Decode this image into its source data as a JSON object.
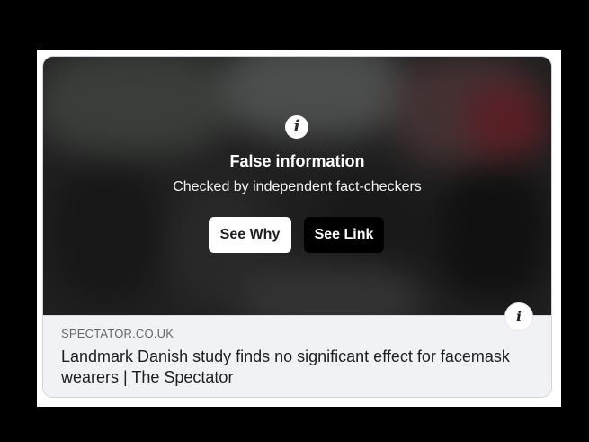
{
  "overlay": {
    "icon": "info-icon",
    "title": "False information",
    "subtitle": "Checked by independent fact-checkers",
    "see_why_label": "See Why",
    "see_link_label": "See Link"
  },
  "link_preview": {
    "domain": "SPECTATOR.CO.UK",
    "headline": "Landmark Danish study finds no significant effect for facemask wearers | The Spectator",
    "info_icon": "info-icon"
  },
  "colors": {
    "background": "#000000",
    "panel": "#ffffff",
    "footer": "#f0f2f5",
    "see_why_bg": "#ffffff",
    "see_link_bg": "#000000"
  }
}
